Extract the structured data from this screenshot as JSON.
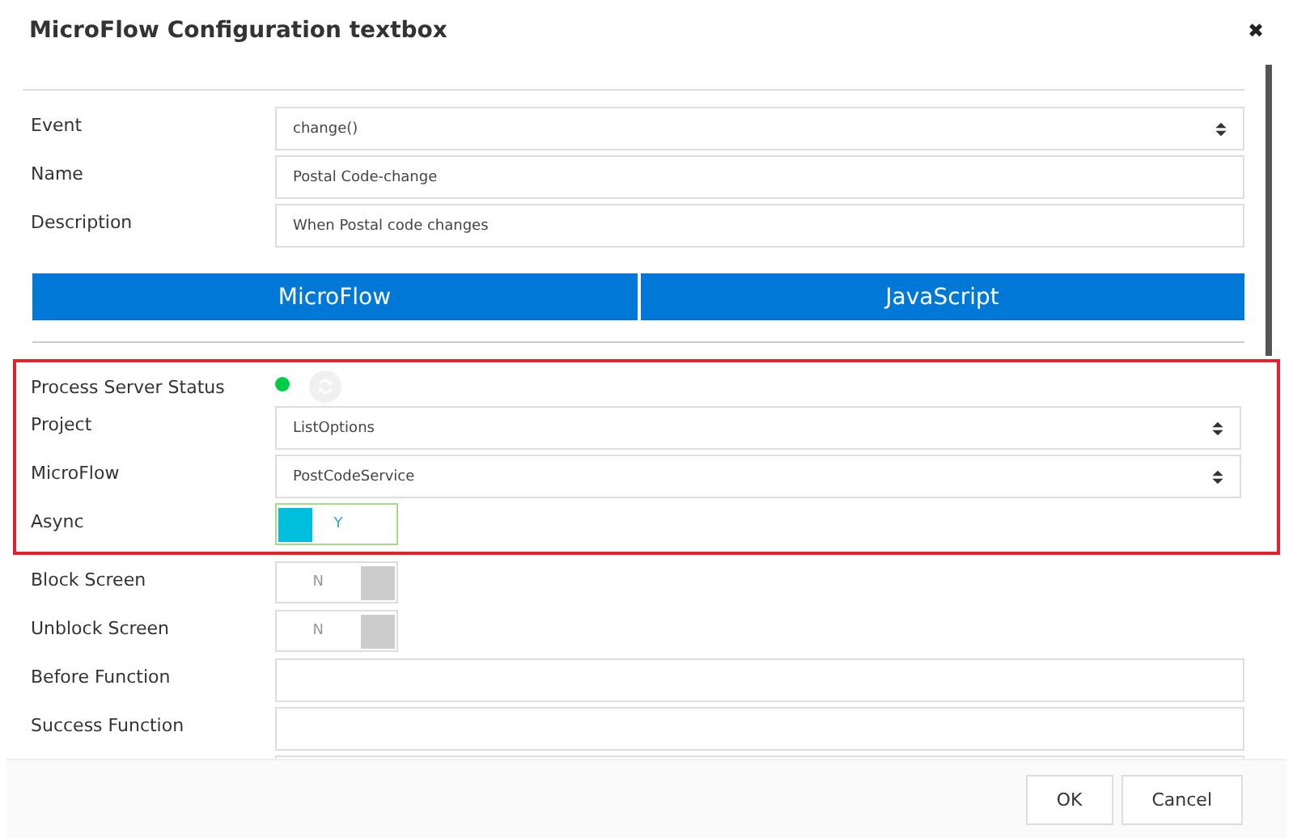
{
  "dialog": {
    "title": "MicroFlow Configuration textbox",
    "close": "✖"
  },
  "fields": [
    {
      "label": "Event",
      "kind": "select",
      "value": "change()"
    },
    {
      "label": "Name",
      "kind": "text",
      "value": "Postal Code-change"
    },
    {
      "label": "Description",
      "kind": "text",
      "value": "When Postal code changes"
    }
  ],
  "tabs": [
    "MicroFlow",
    "JavaScript"
  ],
  "highlighted_settings": [
    {
      "label": "Process Server Status",
      "kind": "status",
      "color": "#00cc44"
    },
    {
      "label": "Project",
      "kind": "select",
      "value": "ListOptions"
    },
    {
      "label": "MicroFlow",
      "kind": "select",
      "value": "PostCodeService"
    },
    {
      "label": "Async",
      "kind": "toggle",
      "on": true,
      "value": "Y"
    }
  ],
  "settings": [
    {
      "label": "Block Screen",
      "kind": "toggle",
      "on": false,
      "value": "N"
    },
    {
      "label": "Unblock Screen",
      "kind": "toggle",
      "on": false,
      "value": "N"
    },
    {
      "label": "Before Function",
      "kind": "text"
    },
    {
      "label": "Success Function",
      "kind": "text"
    },
    {
      "kind": "text"
    }
  ],
  "footer": {
    "buttons": [
      "OK",
      "Cancel"
    ]
  }
}
